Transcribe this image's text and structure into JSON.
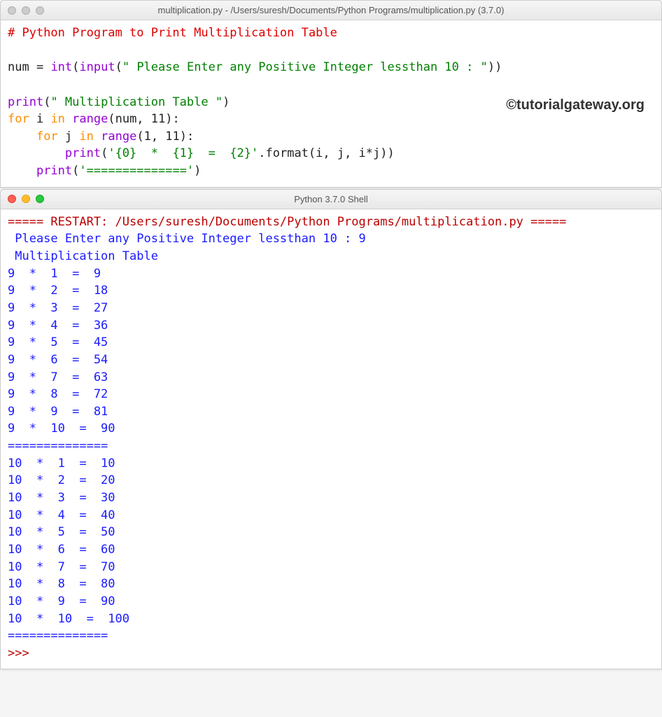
{
  "editor": {
    "title": "multiplication.py - /Users/suresh/Documents/Python Programs/multiplication.py (3.7.0)",
    "l1": "# Python Program to Print Multiplication Table",
    "l3a": "num ",
    "l3b": "= ",
    "l3c": "int",
    "l3d": "(",
    "l3e": "input",
    "l3f": "(",
    "l3g": "\" Please Enter any Positive Integer lessthan 10 : \"",
    "l3h": "))",
    "l5a": "print",
    "l5b": "(",
    "l5c": "\" Multiplication Table \"",
    "l5d": ")",
    "l6a": "for",
    "l6b": " i ",
    "l6c": "in",
    "l6d": " ",
    "l6e": "range",
    "l6f": "(num, ",
    "l6g": "11",
    "l6h": "):",
    "l7a": "    ",
    "l7b": "for",
    "l7c": " j ",
    "l7d": "in",
    "l7e": " ",
    "l7f": "range",
    "l7g": "(",
    "l7h": "1",
    "l7i": ", ",
    "l7j": "11",
    "l7k": "):",
    "l8a": "        ",
    "l8b": "print",
    "l8c": "(",
    "l8d": "'{0}  *  {1}  =  {2}'",
    "l8e": ".format(i, j, i*j))",
    "l9a": "    ",
    "l9b": "print",
    "l9c": "(",
    "l9d": "'=============='",
    "l9e": ")"
  },
  "watermark": "©tutorialgateway.org",
  "shell": {
    "title": "Python 3.7.0 Shell",
    "restart": "===== RESTART: /Users/suresh/Documents/Python Programs/multiplication.py =====",
    "prompt_line": " Please Enter any Positive Integer lessthan 10 : 9",
    "heading": " Multiplication Table ",
    "rows": [
      "9  *  1  =  9",
      "9  *  2  =  18",
      "9  *  3  =  27",
      "9  *  4  =  36",
      "9  *  5  =  45",
      "9  *  6  =  54",
      "9  *  7  =  63",
      "9  *  8  =  72",
      "9  *  9  =  81",
      "9  *  10  =  90",
      "==============",
      "10  *  1  =  10",
      "10  *  2  =  20",
      "10  *  3  =  30",
      "10  *  4  =  40",
      "10  *  5  =  50",
      "10  *  6  =  60",
      "10  *  7  =  70",
      "10  *  8  =  80",
      "10  *  9  =  90",
      "10  *  10  =  100",
      "=============="
    ],
    "prompt": ">>> "
  }
}
